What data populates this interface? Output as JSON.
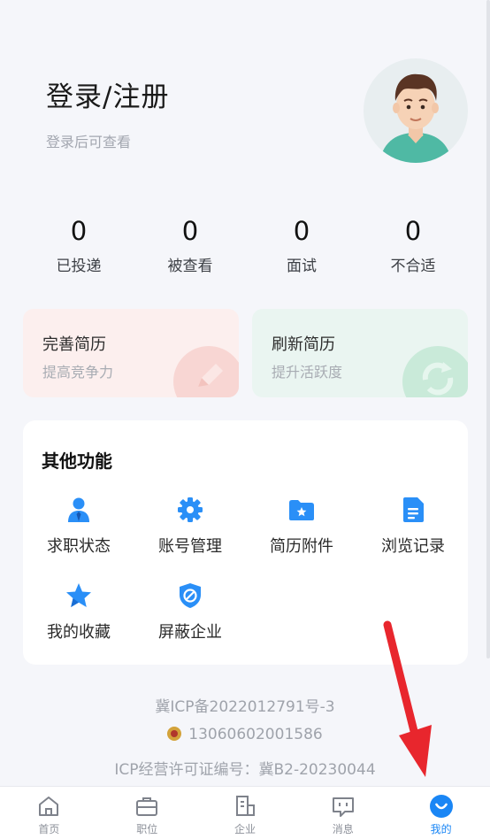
{
  "profile": {
    "title": "登录/注册",
    "subtitle": "登录后可查看",
    "avatar_icon": "user-avatar-icon"
  },
  "stats": [
    {
      "value": "0",
      "label": "已投递"
    },
    {
      "value": "0",
      "label": "被查看"
    },
    {
      "value": "0",
      "label": "面试"
    },
    {
      "value": "0",
      "label": "不合适"
    }
  ],
  "cards": {
    "resume": {
      "title": "完善简历",
      "subtitle": "提高竞争力"
    },
    "refresh": {
      "title": "刷新简历",
      "subtitle": "提升活跃度"
    }
  },
  "features": {
    "title": "其他功能",
    "items": [
      {
        "label": "求职状态",
        "icon": "job-status-icon"
      },
      {
        "label": "账号管理",
        "icon": "gear-icon"
      },
      {
        "label": "简历附件",
        "icon": "folder-star-icon"
      },
      {
        "label": "浏览记录",
        "icon": "document-icon"
      },
      {
        "label": "我的收藏",
        "icon": "star-icon"
      },
      {
        "label": "屏蔽企业",
        "icon": "block-shield-icon"
      }
    ]
  },
  "footer": {
    "icp": "冀ICP备2022012791号-3",
    "police_record": "13060602001586",
    "license": "ICP经营许可证编号：冀B2-20230044"
  },
  "tabbar": {
    "items": [
      {
        "label": "首页",
        "icon": "home-icon"
      },
      {
        "label": "职位",
        "icon": "briefcase-icon"
      },
      {
        "label": "企业",
        "icon": "building-icon"
      },
      {
        "label": "消息",
        "icon": "message-icon"
      },
      {
        "label": "我的",
        "icon": "profile-smile-icon"
      }
    ],
    "active_index": 4
  },
  "colors": {
    "accent": "#1a86f5",
    "arrow": "#e8262d"
  }
}
